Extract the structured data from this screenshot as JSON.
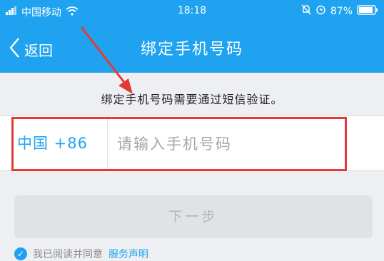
{
  "status_bar": {
    "carrier": "中国移动",
    "time": "18:18",
    "battery_percent": "87%"
  },
  "nav": {
    "back_label": "返回",
    "title": "绑定手机号码"
  },
  "hint": "绑定手机号码需要通过短信验证。",
  "phone": {
    "country_label": "中国 +86",
    "placeholder": "请输入手机号码",
    "value": ""
  },
  "next_button": "下一步",
  "agreement": {
    "prefix": "我已阅读并同意",
    "link": "服务声明"
  },
  "colors": {
    "accent": "#1fa3f0",
    "annotation_red": "#e53935"
  },
  "icons": [
    "wifi-icon",
    "chevron-left-icon",
    "bell-off-icon",
    "alarm-icon",
    "battery-icon",
    "check-icon",
    "annotation-arrow"
  ]
}
